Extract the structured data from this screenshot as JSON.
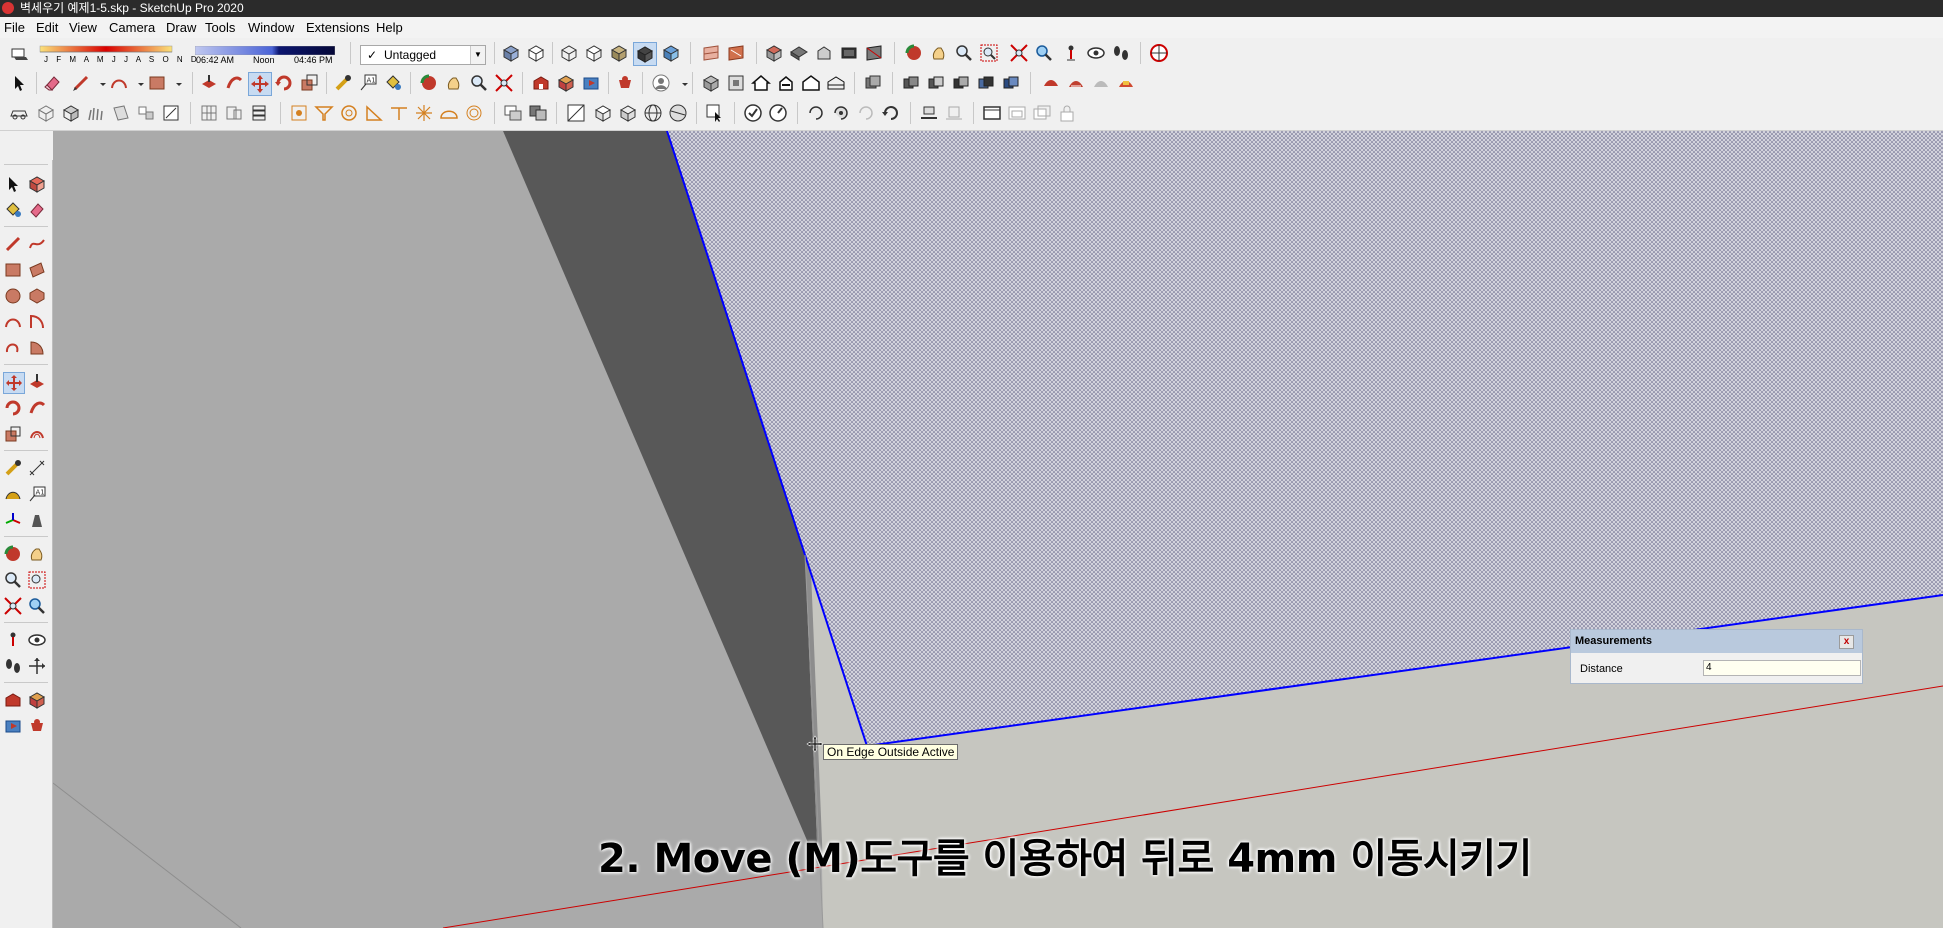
{
  "window": {
    "title": "벽세우기 예제1-5.skp - SketchUp Pro 2020"
  },
  "menu": [
    "File",
    "Edit",
    "View",
    "Camera",
    "Draw",
    "Tools",
    "Window",
    "Extensions",
    "Help"
  ],
  "shadow": {
    "months": "J F M A M J J A S O N D",
    "time_start": "06:42 AM",
    "time_mid": "Noon",
    "time_end": "04:46 PM"
  },
  "tag": {
    "current": "Untagged"
  },
  "viewport": {
    "inference_tooltip": "On Edge Outside Active",
    "subtitle": "2. Move (M)도구를 이용하여 뒤로 4mm 이동시키기"
  },
  "measurements": {
    "title": "Measurements",
    "close": "x",
    "label": "Distance",
    "value": "4"
  },
  "colors": {
    "selection_edge": "#0000ff",
    "axis_red": "#cc0000",
    "face_front": "#aaaaaa",
    "face_side": "#585858",
    "sky": "#c6c6c0"
  }
}
